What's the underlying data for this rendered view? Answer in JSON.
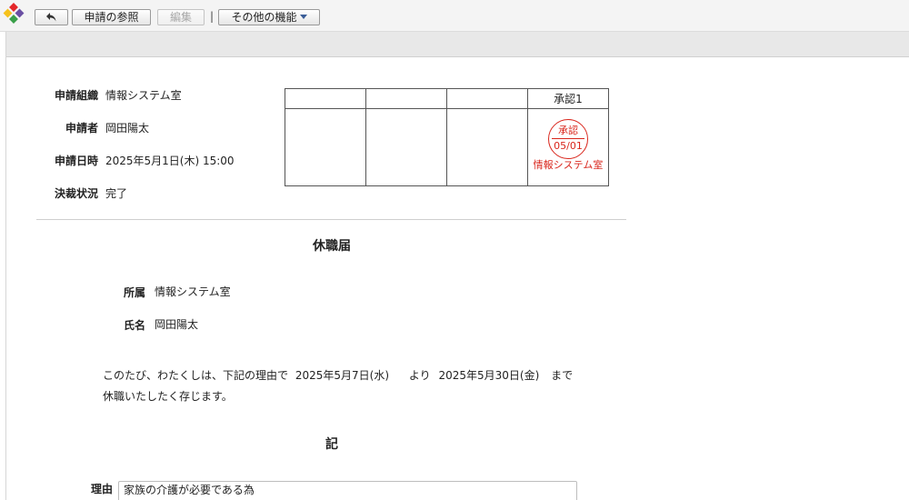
{
  "toolbar": {
    "back_icon": "back-arrow-icon",
    "view_request_label": "申請の参照",
    "edit_label": "編集",
    "separator": "|",
    "more_label": "その他の機能",
    "more_icon": "caret-down-icon"
  },
  "logo": {
    "icon": "app-logo-icon",
    "colors": [
      "#e4262a",
      "#f6c21c",
      "#3aa04a",
      "#6a4fa3"
    ]
  },
  "info": {
    "org_label": "申請組織",
    "org_value": "情報システム室",
    "applicant_label": "申請者",
    "applicant_value": "岡田陽太",
    "datetime_label": "申請日時",
    "datetime_value": "2025年5月1日(木) 15:00",
    "status_label": "決裁状況",
    "status_value": "完了"
  },
  "approval": {
    "headers": [
      "",
      "",
      "",
      "承認1"
    ],
    "stamp": {
      "top": "承認",
      "date": "05/01",
      "org": "情報システム室",
      "color": "#d9261c"
    }
  },
  "document": {
    "title": "休職届",
    "dept_label": "所属",
    "dept_value": "情報システム室",
    "name_label": "氏名",
    "name_value": "岡田陽太",
    "line1_a": "このたび、わたくしは、下記の理由で",
    "start_date": "2025年5月7日(水)",
    "from_word": "より",
    "end_date": "2025年5月30日(金)",
    "until_word": "まで",
    "line2": "休職いたしたく存じます。",
    "ki": "記",
    "reason_label": "理由",
    "reason_value": "家族の介護が必要である為"
  }
}
